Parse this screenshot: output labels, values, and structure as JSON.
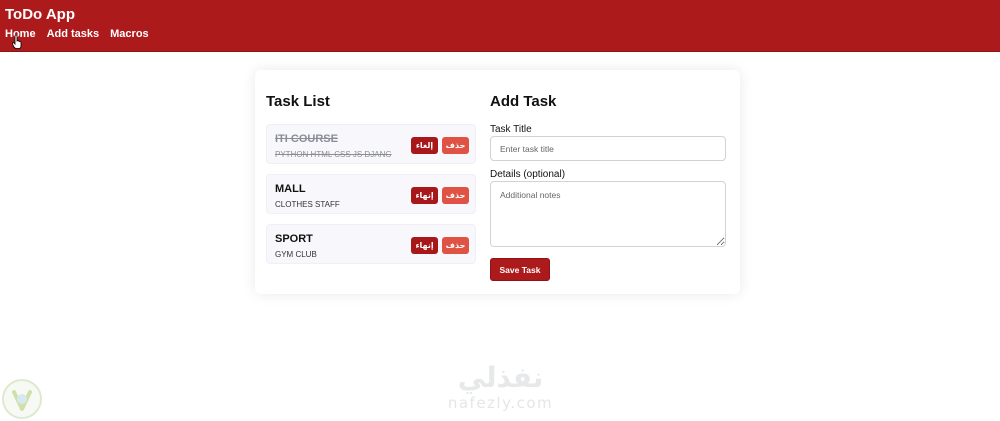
{
  "navbar": {
    "brand": "ToDo App",
    "links": [
      "Home",
      "Add tasks",
      "Macros"
    ]
  },
  "task_list": {
    "heading": "Task List",
    "tasks": [
      {
        "title": "ITI COURSE",
        "details": "PYTHON HTML CSS JS DJANG",
        "done": true,
        "finish_label": "إلغاء",
        "delete_label": "حذف"
      },
      {
        "title": "MALL",
        "details": "CLOTHES STAFF",
        "done": false,
        "finish_label": "إنهاء",
        "delete_label": "حذف"
      },
      {
        "title": "SPORT",
        "details": "GYM CLUB",
        "done": false,
        "finish_label": "إنهاء",
        "delete_label": "حذف"
      }
    ]
  },
  "add_task": {
    "heading": "Add Task",
    "title_label": "Task Title",
    "title_placeholder": "Enter task title",
    "details_label": "Details (optional)",
    "details_placeholder": "Additional notes",
    "save_label": "Save Task"
  },
  "watermark": {
    "arabic": "نفذلي",
    "latin": "nafezly.com"
  },
  "colors": {
    "navbar": "#ad1a1c",
    "finish_button": "#a8181b",
    "delete_button": "#e05344",
    "save_button": "#ac1a1c"
  },
  "icons": {
    "cursor": "hand-pointer-icon",
    "logo": "nafezly-logo-icon"
  }
}
